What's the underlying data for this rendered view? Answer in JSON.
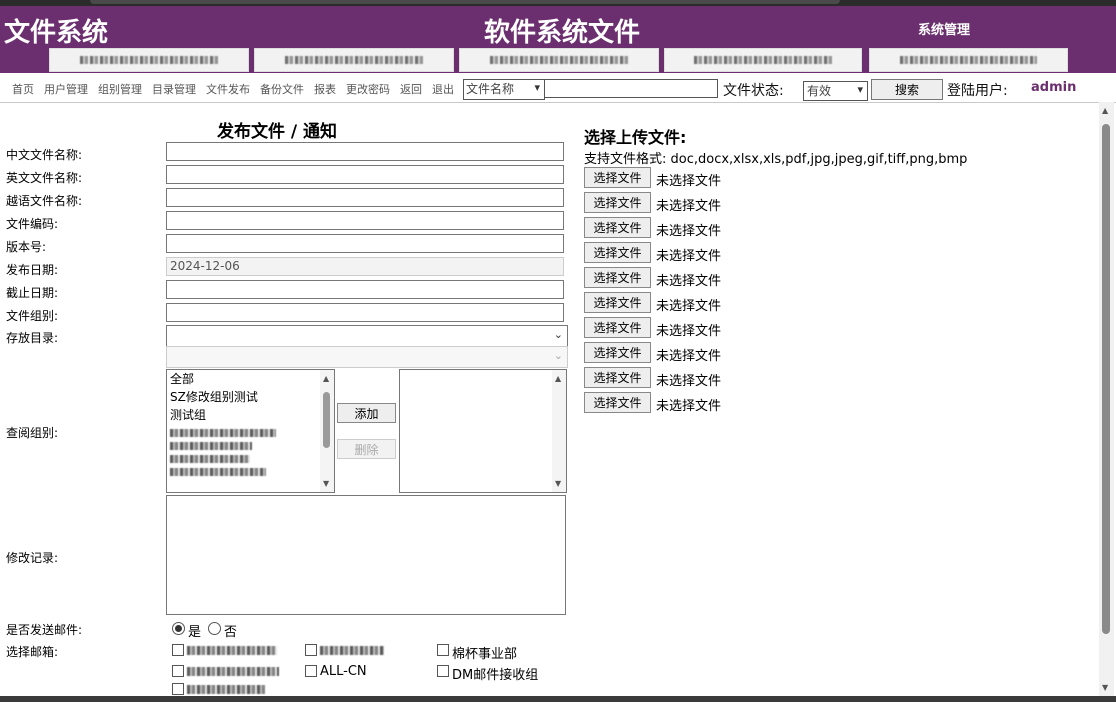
{
  "header": {
    "logo": "文件系统",
    "title": "软件系统文件",
    "system_manage": "系统管理"
  },
  "nav": {
    "items": [
      "首页",
      "用户管理",
      "组别管理",
      "目录管理",
      "文件发布",
      "备份文件",
      "报表",
      "更改密码",
      "返回",
      "退出"
    ],
    "search_field_select": "文件名称",
    "search_value": "",
    "status_label": "文件状态:",
    "status_value": "有效",
    "search_button": "搜索",
    "login_label": "登陆用户:",
    "login_user": "admin"
  },
  "form": {
    "title": "发布文件 / 通知",
    "labels": {
      "cn_name": "中文文件名称:",
      "en_name": "英文文件名称:",
      "vn_name": "越语文件名称:",
      "file_code": "文件编码:",
      "version": "版本号:",
      "publish_date": "发布日期:",
      "deadline": "截止日期:",
      "file_group": "文件组别:",
      "store_dir": "存放目录:",
      "view_group": "查阅组别:",
      "change_log": "修改记录:",
      "send_mail": "是否发送邮件:",
      "select_mail": "选择邮箱:"
    },
    "publish_date_value": "2024-12-06",
    "groups_list": [
      "全部",
      "SZ修改组别测试",
      "测试组"
    ],
    "add_button": "添加",
    "delete_button": "删除",
    "mail_yes": "是",
    "mail_no": "否",
    "mailboxes": [
      "棉杯事业部",
      "ALL-CN",
      "DM邮件接收组"
    ]
  },
  "upload": {
    "title": "选择上传文件:",
    "formats": "支持文件格式: doc,docx,xlsx,xls,pdf,jpg,jpeg,gif,tiff,png,bmp",
    "choose_button": "选择文件",
    "no_file": "未选择文件"
  }
}
